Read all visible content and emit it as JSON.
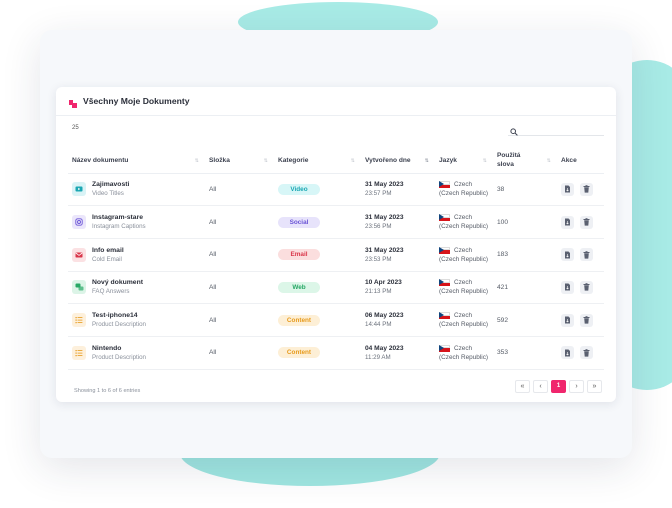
{
  "header": {
    "title": "Všechny Moje Dokumenty"
  },
  "toolbar": {
    "page_size": "25",
    "search_placeholder": ""
  },
  "table": {
    "columns": [
      "Název dokumentu",
      "Složka",
      "Kategorie",
      "Vytvořeno dne",
      "Jazyk",
      "Použitá slova",
      "Akce"
    ],
    "rows": [
      {
        "name": "Zajimavosti",
        "sub": "Video Titles",
        "folder": "All",
        "category": "Video",
        "cat_color": "#d7f6f7",
        "cat_text": "#1aa7b3",
        "icon_bg": "#d9f3f6",
        "icon_color": "#1aa7b3",
        "icon": "video-icon",
        "date": "31 May 2023",
        "time": "23:57 PM",
        "lang1": "Czech",
        "lang2": "(Czech Republic)",
        "words": "38"
      },
      {
        "name": "Instagram-stare",
        "sub": "Instagram Captions",
        "folder": "All",
        "category": "Social",
        "cat_color": "#e7e3fb",
        "cat_text": "#6b55d6",
        "icon_bg": "#ebe6fb",
        "icon_color": "#6b55d6",
        "icon": "instagram-icon",
        "date": "31 May 2023",
        "time": "23:56 PM",
        "lang1": "Czech",
        "lang2": "(Czech Republic)",
        "words": "100"
      },
      {
        "name": "Info email",
        "sub": "Cold Email",
        "folder": "All",
        "category": "Email",
        "cat_color": "#fbdede",
        "cat_text": "#d9364a",
        "icon_bg": "#fbe1e3",
        "icon_color": "#d9364a",
        "icon": "email-icon",
        "date": "31 May 2023",
        "time": "23:53 PM",
        "lang1": "Czech",
        "lang2": "(Czech Republic)",
        "words": "183"
      },
      {
        "name": "Nový dokument",
        "sub": "FAQ Answers",
        "folder": "All",
        "category": "Web",
        "cat_color": "#dcf6e8",
        "cat_text": "#27a865",
        "icon_bg": "#dcf4e7",
        "icon_color": "#27a865",
        "icon": "chat-icon",
        "date": "10 Apr 2023",
        "time": "21:13 PM",
        "lang1": "Czech",
        "lang2": "(Czech Republic)",
        "words": "421"
      },
      {
        "name": "Test-iphone14",
        "sub": "Product Description",
        "folder": "All",
        "category": "Content",
        "cat_color": "#fdefd6",
        "cat_text": "#e79a1b",
        "icon_bg": "#fdf0dc",
        "icon_color": "#e79a1b",
        "icon": "list-icon",
        "date": "06 May 2023",
        "time": "14:44 PM",
        "lang1": "Czech",
        "lang2": "(Czech Republic)",
        "words": "592"
      },
      {
        "name": "Nintendo",
        "sub": "Product Description",
        "folder": "All",
        "category": "Content",
        "cat_color": "#fdefd6",
        "cat_text": "#e79a1b",
        "icon_bg": "#fdf0dc",
        "icon_color": "#e79a1b",
        "icon": "list-icon",
        "date": "04 May 2023",
        "time": "11:29 AM",
        "lang1": "Czech",
        "lang2": "(Czech Republic)",
        "words": "353"
      }
    ]
  },
  "footer": {
    "showing": "Showing 1 to 6 of 6 entries",
    "pager": [
      "«",
      "‹",
      "1",
      "›",
      "»"
    ],
    "active_page": "1"
  },
  "colors": {
    "accent": "#f0266d",
    "teal_bg": "#a8ebe6"
  }
}
